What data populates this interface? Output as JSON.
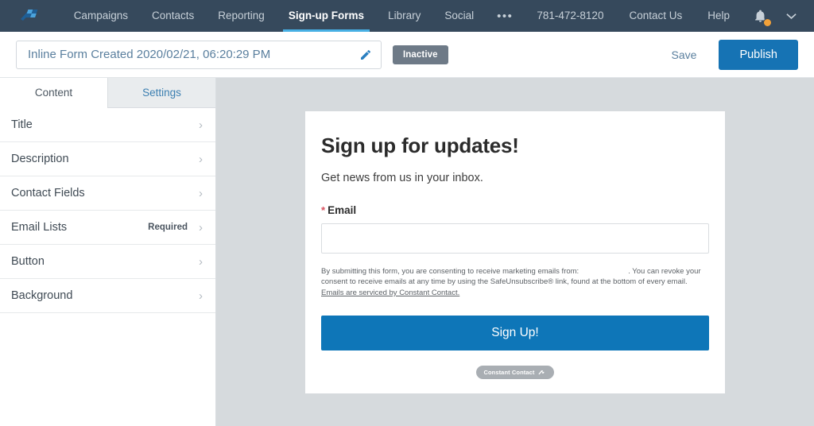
{
  "topnav": {
    "logo_icon": "constant-contact-logo",
    "items": [
      {
        "label": "Campaigns",
        "active": false
      },
      {
        "label": "Contacts",
        "active": false
      },
      {
        "label": "Reporting",
        "active": false
      },
      {
        "label": "Sign-up Forms",
        "active": true
      },
      {
        "label": "Library",
        "active": false
      },
      {
        "label": "Social",
        "active": false
      }
    ],
    "overflow": "•••",
    "phone": "781-472-8120",
    "contact_us": "Contact Us",
    "help": "Help",
    "bell_icon": "notification-bell-icon",
    "bell_badge_color": "#f2a139",
    "caret_icon": "chevron-down-icon",
    "background": "#36495c",
    "active_underline": "#48b0e4"
  },
  "actionbar": {
    "form_title": "Inline Form Created 2020/02/21, 06:20:29 PM",
    "form_title_placeholder": "Form name",
    "edit_icon": "pencil-icon",
    "status": "Inactive",
    "status_color": "#6e7a87",
    "save_label": "Save",
    "publish_label": "Publish",
    "publish_color": "#1673b4"
  },
  "sidebar": {
    "tabs": [
      {
        "label": "Content",
        "active": true
      },
      {
        "label": "Settings",
        "active": false
      }
    ],
    "items": [
      {
        "label": "Title",
        "badge": ""
      },
      {
        "label": "Description",
        "badge": ""
      },
      {
        "label": "Contact Fields",
        "badge": ""
      },
      {
        "label": "Email Lists",
        "badge": "Required"
      },
      {
        "label": "Button",
        "badge": ""
      },
      {
        "label": "Background",
        "badge": ""
      }
    ],
    "chevron_icon": "chevron-right-icon"
  },
  "canvas": {
    "background": "#d6dadd",
    "form": {
      "heading": "Sign up for updates!",
      "subheading": "Get news from us in your inbox.",
      "email_label": "Email",
      "required_marker": "*",
      "email_value": "",
      "email_placeholder": "",
      "fineprint_part1": "By submitting this form, you are consenting to receive marketing emails from:",
      "fineprint_part2": ". You can revoke your consent to receive emails at any time by using the SafeUnsubscribe® link, found at the bottom of every email.",
      "fineprint_link": "Emails are serviced by Constant Contact.",
      "submit_label": "Sign Up!",
      "submit_color": "#0e76b8",
      "badge_text": "Constant Contact",
      "badge_icon": "constant-contact-mini-logo"
    }
  }
}
